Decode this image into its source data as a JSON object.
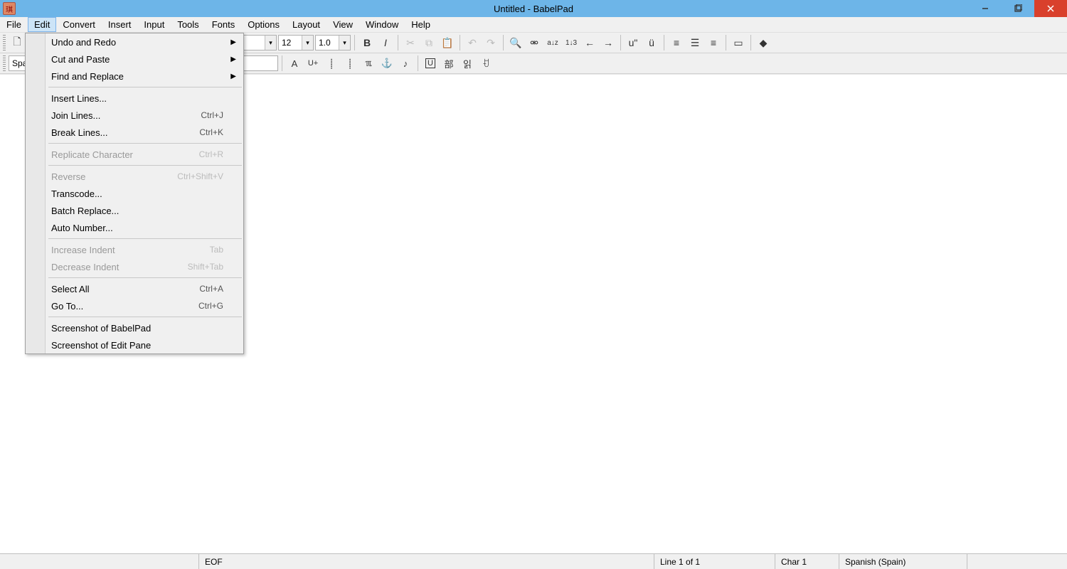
{
  "window": {
    "title": "Untitled - BabelPad",
    "controls": {
      "minimize": "–",
      "maximize": "❐",
      "close": "✕"
    }
  },
  "menubar": [
    "File",
    "Edit",
    "Convert",
    "Insert",
    "Input",
    "Tools",
    "Fonts",
    "Options",
    "Layout",
    "View",
    "Window",
    "Help"
  ],
  "active_menu_index": 1,
  "toolbar": {
    "font_name": "",
    "font_size": "12",
    "line_spacing": "1.0",
    "lang_combo": "Spa"
  },
  "edit_menu": {
    "groups": [
      [
        {
          "label": "Undo and Redo",
          "sub": true
        },
        {
          "label": "Cut and Paste",
          "sub": true
        },
        {
          "label": "Find and Replace",
          "sub": true
        }
      ],
      [
        {
          "label": "Insert Lines..."
        },
        {
          "label": "Join Lines...",
          "shortcut": "Ctrl+J"
        },
        {
          "label": "Break Lines...",
          "shortcut": "Ctrl+K"
        }
      ],
      [
        {
          "label": "Replicate Character",
          "shortcut": "Ctrl+R",
          "disabled": true
        }
      ],
      [
        {
          "label": "Reverse",
          "shortcut": "Ctrl+Shift+V",
          "disabled": true
        },
        {
          "label": "Transcode..."
        },
        {
          "label": "Batch Replace..."
        },
        {
          "label": "Auto Number..."
        }
      ],
      [
        {
          "label": "Increase Indent",
          "shortcut": "Tab",
          "disabled": true
        },
        {
          "label": "Decrease Indent",
          "shortcut": "Shift+Tab",
          "disabled": true
        }
      ],
      [
        {
          "label": "Select All",
          "shortcut": "Ctrl+A"
        },
        {
          "label": "Go To...",
          "shortcut": "Ctrl+G"
        }
      ],
      [
        {
          "label": "Screenshot of BabelPad"
        },
        {
          "label": "Screenshot of Edit Pane"
        }
      ]
    ]
  },
  "statusbar": {
    "eof": "EOF",
    "line": "Line 1 of 1",
    "char": "Char 1",
    "lang": "Spanish (Spain)"
  }
}
